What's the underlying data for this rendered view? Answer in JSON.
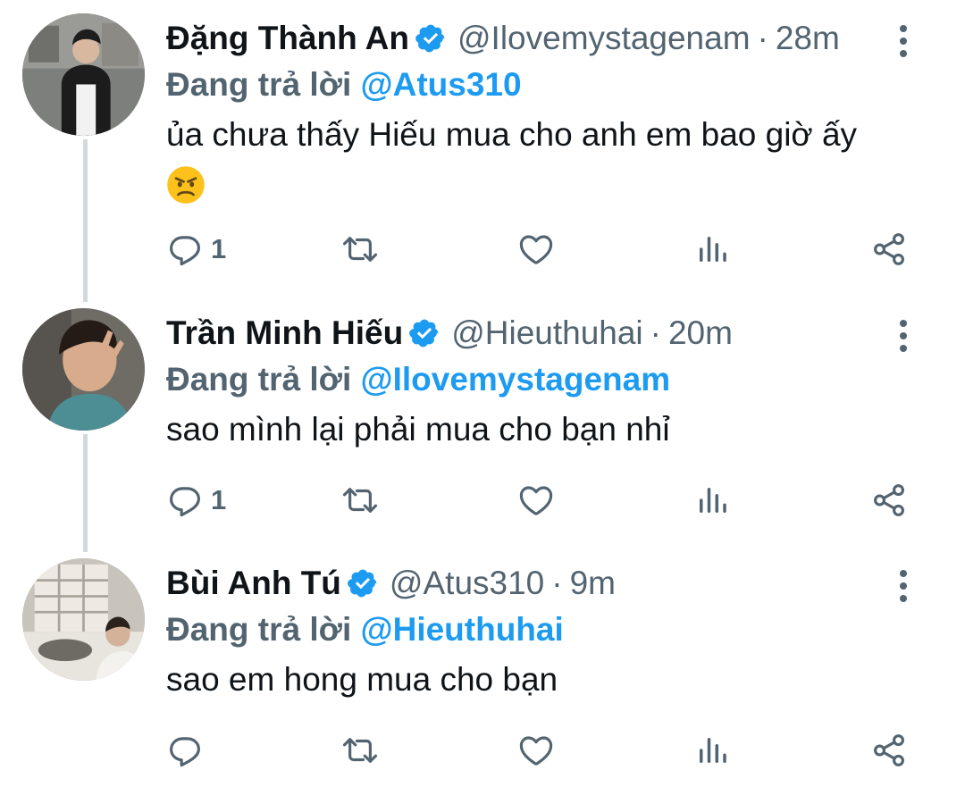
{
  "colors": {
    "accent": "#1d9bf0",
    "muted": "#536471",
    "text": "#0f1419",
    "thread_line": "#cfd9de"
  },
  "tweets": [
    {
      "name": "Đặng Thành An",
      "handle": "@Ilovemystagenam",
      "separator": "·",
      "time": "28m",
      "replying_prefix": "Đang trả lời",
      "replying_to": "@Atus310",
      "text": "ủa chưa thấy Hiếu mua cho anh em bao giờ ấy",
      "emoji": "angry-face-emoji",
      "reply_count": "1",
      "icons": [
        "verified-badge-icon",
        "more-options-icon",
        "reply-icon",
        "retweet-icon",
        "like-icon",
        "analytics-icon",
        "share-icon"
      ]
    },
    {
      "name": "Trần Minh Hiếu",
      "handle": "@Hieuthuhai",
      "separator": "·",
      "time": "20m",
      "replying_prefix": "Đang trả lời",
      "replying_to": "@Ilovemystagenam",
      "text": "sao mình lại phải mua cho bạn nhỉ",
      "reply_count": "1",
      "icons": [
        "verified-badge-icon",
        "more-options-icon",
        "reply-icon",
        "retweet-icon",
        "like-icon",
        "analytics-icon",
        "share-icon"
      ]
    },
    {
      "name": "Bùi Anh Tú",
      "handle": "@Atus310",
      "separator": "·",
      "time": "9m",
      "replying_prefix": "Đang trả lời",
      "replying_to": "@Hieuthuhai",
      "text": "sao em hong mua cho bạn",
      "reply_count": "",
      "icons": [
        "verified-badge-icon",
        "more-options-icon",
        "reply-icon",
        "retweet-icon",
        "like-icon",
        "analytics-icon",
        "share-icon"
      ]
    }
  ]
}
